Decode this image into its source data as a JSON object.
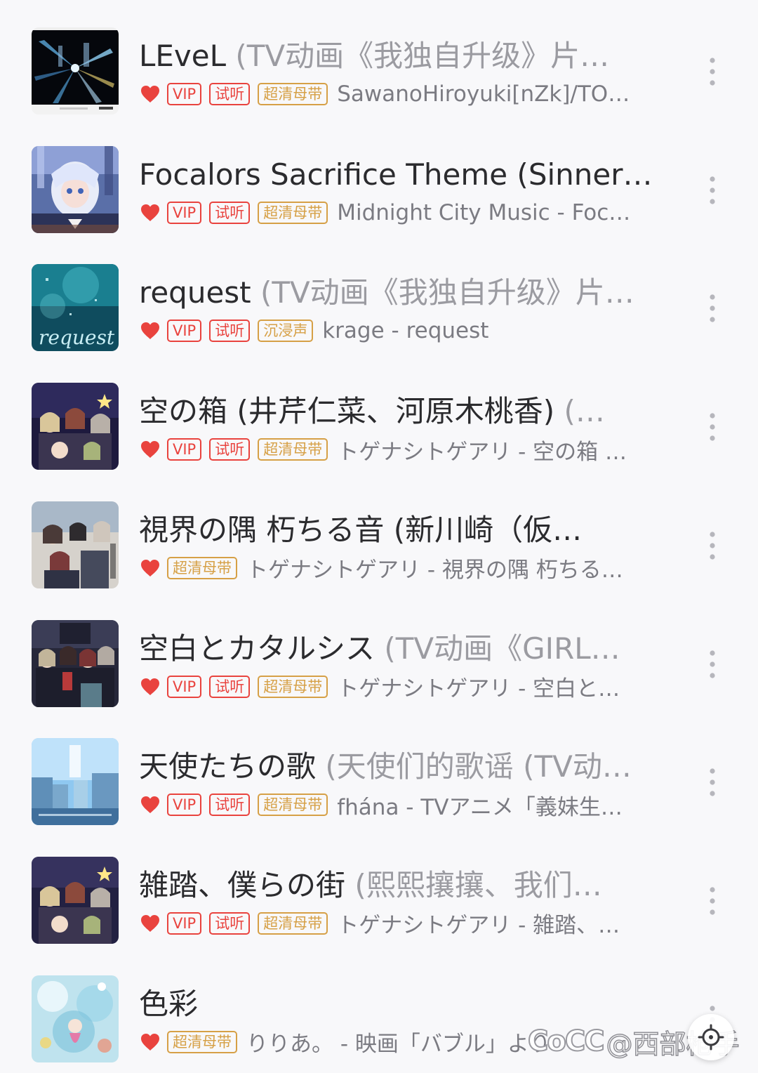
{
  "songs": [
    {
      "title": "LEveL",
      "subtitle": " (TV动画《我独自升级》片…",
      "liked": true,
      "tags": [
        "VIP",
        "试听",
        "超清母带"
      ],
      "artist": "SawanoHiroyuki[nZk]/TO…",
      "cover": "cover-level"
    },
    {
      "title": "Focalors Sacrifice Theme (Sinner…",
      "subtitle": "",
      "liked": true,
      "tags": [
        "VIP",
        "试听",
        "超清母带"
      ],
      "artist": "Midnight City Music - Foc…",
      "cover": "cover-focalors"
    },
    {
      "title": "request",
      "subtitle": " (TV动画《我独自升级》片…",
      "liked": true,
      "tags": [
        "VIP",
        "试听",
        "沉浸声"
      ],
      "artist": "krage - request",
      "cover": "cover-request"
    },
    {
      "title": "空の箱 (井芹仁菜、河原木桃香)",
      "subtitle": " (…",
      "liked": true,
      "tags": [
        "VIP",
        "试听",
        "超清母带"
      ],
      "artist": "トゲナシトゲアリ - 空の箱 …",
      "cover": "cover-sora"
    },
    {
      "title": "視界の隅 朽ちる音 (新川崎（仮…",
      "subtitle": "",
      "liked": true,
      "tags": [
        "超清母带"
      ],
      "artist": "トゲナシトゲアリ - 視界の隅 朽ちる…",
      "cover": "cover-shikai"
    },
    {
      "title": "空白とカタルシス",
      "subtitle": " (TV动画《GIRL…",
      "liked": true,
      "tags": [
        "VIP",
        "试听",
        "超清母带"
      ],
      "artist": "トゲナシトゲアリ - 空白と…",
      "cover": "cover-kuuhaku"
    },
    {
      "title": "天使たちの歌",
      "subtitle": " (天使们的歌谣 (TV动…",
      "liked": true,
      "tags": [
        "VIP",
        "试听",
        "超清母带"
      ],
      "artist": "fhána - TVアニメ「義妹生…",
      "cover": "cover-tenshi"
    },
    {
      "title": "雑踏、僕らの街",
      "subtitle": " (熙熙攘攘、我们…",
      "liked": true,
      "tags": [
        "VIP",
        "试听",
        "超清母带"
      ],
      "artist": "トゲナシトゲアリ - 雑踏、…",
      "cover": "cover-zattou"
    },
    {
      "title": "色彩",
      "subtitle": "",
      "liked": true,
      "tags": [
        "超清母带"
      ],
      "artist": "りりあ。 - 映画「バブル」より",
      "cover": "cover-shikisai"
    }
  ],
  "watermark": {
    "logo": "CoCC",
    "handle": "@西部枪手"
  },
  "colors": {
    "heart": "#e9433e",
    "tag_red": "#e9433e",
    "tag_gold": "#d6a046",
    "title": "#2b2b2e",
    "subtitle": "#9b9ba1",
    "artist": "#7b7b82",
    "background": "#f8f8fa"
  },
  "icons": {
    "like": "heart-icon",
    "more": "more-vertical-icon",
    "fab": "locate-icon"
  }
}
